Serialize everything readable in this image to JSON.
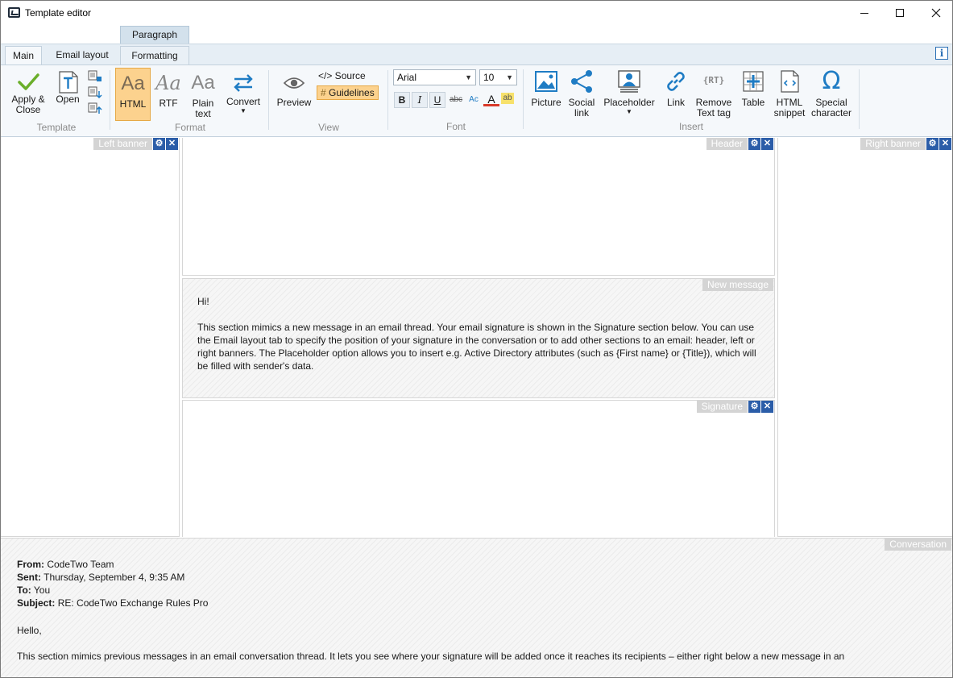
{
  "window": {
    "title": "Template editor"
  },
  "context_group": "Paragraph",
  "tabs": [
    {
      "label": "Main"
    },
    {
      "label": "Email layout"
    },
    {
      "label": "Formatting"
    }
  ],
  "info_label": "i",
  "ribbon": {
    "template": {
      "group_label": "Template",
      "apply_close_line1": "Apply &",
      "apply_close_line2": "Close",
      "open": "Open"
    },
    "format": {
      "group_label": "Format",
      "html": "HTML",
      "rtf": "RTF",
      "plain_line1": "Plain",
      "plain_line2": "text",
      "convert": "Convert",
      "glyph": "Aa"
    },
    "view": {
      "group_label": "View",
      "preview": "Preview",
      "source": "</> Source",
      "guidelines": "Guidelines"
    },
    "font": {
      "group_label": "Font",
      "family": "Arial",
      "size": "10",
      "bold": "B",
      "italic": "I",
      "underline": "U",
      "strike": "abc",
      "case": "Ac",
      "color": "A",
      "highlight": "ab"
    },
    "insert": {
      "group_label": "Insert",
      "picture": "Picture",
      "social_line1": "Social",
      "social_line2": "link",
      "placeholder": "Placeholder",
      "link": "Link",
      "remove_line1": "Remove",
      "remove_line2": "Text tag",
      "rt_glyph": "RT",
      "table": "Table",
      "snippet_line1": "HTML",
      "snippet_line2": "snippet",
      "special_line1": "Special",
      "special_line2": "character",
      "omega": "Ω"
    }
  },
  "zones": {
    "left_banner": "Left banner",
    "header": "Header",
    "right_banner": "Right banner",
    "new_message": "New message",
    "signature": "Signature",
    "conversation": "Conversation"
  },
  "new_message": {
    "greeting": "Hi!",
    "body": "This section mimics a new message in an email thread. Your email signature is shown in the Signature section below. You can use the Email layout tab to specify the position of your signature in the conversation or to add other sections to an email: header, left or right banners. The Placeholder option allows you to insert e.g. Active Directory attributes (such as {First name} or {Title}), which will be filled with sender's data."
  },
  "conversation": {
    "from_label": "From:",
    "from_value": "CodeTwo Team",
    "sent_label": "Sent:",
    "sent_value": "Thursday, September 4, 9:35 AM",
    "to_label": "To:",
    "to_value": "You",
    "subject_label": "Subject:",
    "subject_value": "RE: CodeTwo Exchange Rules Pro",
    "greeting": "Hello,",
    "body": "This section mimics previous messages in an email conversation thread. It lets you see where your signature will be added once it reaches its recipients – either right below a new message in an"
  },
  "colors": {
    "accent_blue": "#2b5da8",
    "selected_orange": "#fcd28e",
    "check_green": "#6aae2a",
    "icon_blue": "#1f7cc4"
  }
}
